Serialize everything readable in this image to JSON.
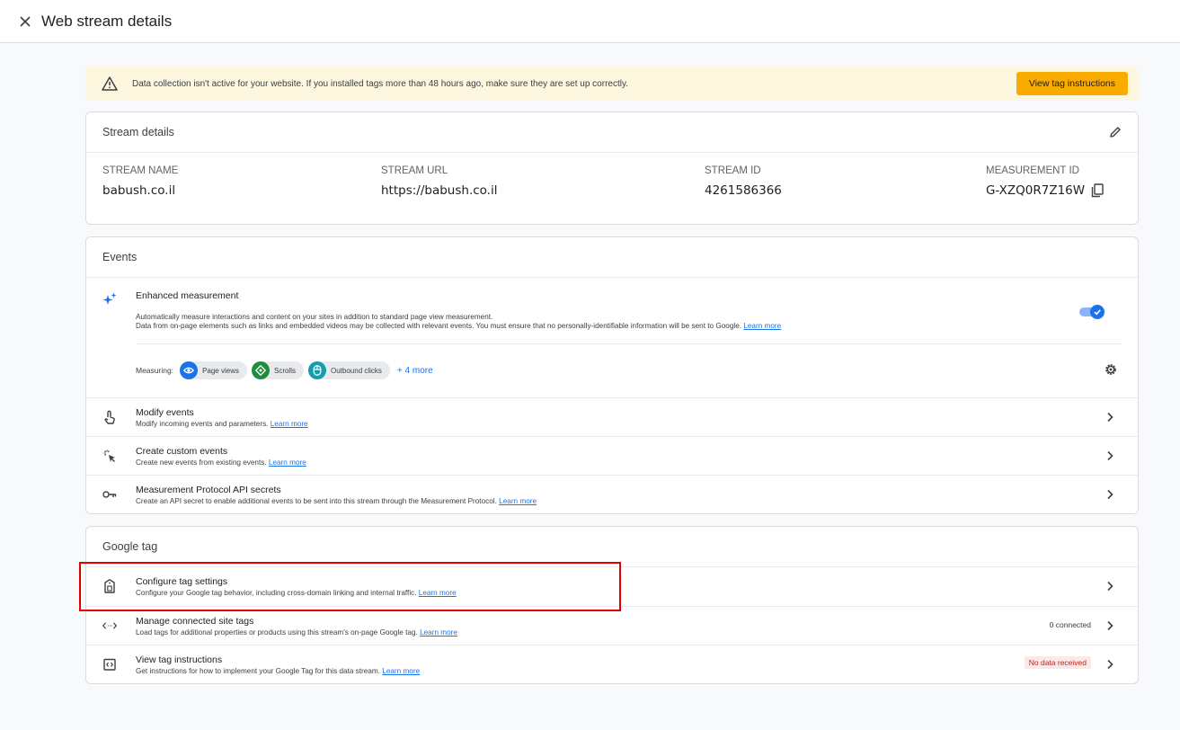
{
  "header": {
    "title": "Web stream details"
  },
  "banner": {
    "message": "Data collection isn't active for your website. If you installed tags more than 48 hours ago, make sure they are set up correctly.",
    "button_label": "View tag instructions"
  },
  "stream_details": {
    "heading": "Stream details",
    "fields": [
      {
        "label": "STREAM NAME",
        "value": "babush.co.il"
      },
      {
        "label": "STREAM URL",
        "value": "https://babush.co.il"
      },
      {
        "label": "STREAM ID",
        "value": "4261586366"
      },
      {
        "label": "MEASUREMENT ID",
        "value": "G-XZQ0R7Z16W"
      }
    ]
  },
  "events": {
    "heading": "Events",
    "enhanced": {
      "title": "Enhanced measurement",
      "desc_line1": "Automatically measure interactions and content on your sites in addition to standard page view measurement.",
      "desc_line2": "Data from on-page elements such as links and embedded videos may be collected with relevant events. You must ensure that no personally-identifiable information will be sent to Google.",
      "learn_more": "Learn more",
      "enabled": true,
      "measuring_label": "Measuring:",
      "chips": [
        {
          "label": "Page views",
          "color": "#1a73e8"
        },
        {
          "label": "Scrolls",
          "color": "#1e8e3e"
        },
        {
          "label": "Outbound clicks",
          "color": "#129eaf"
        }
      ],
      "more_label": "+ 4 more"
    },
    "rows": [
      {
        "title": "Modify events",
        "subtitle": "Modify incoming events and parameters.",
        "link": "Learn more"
      },
      {
        "title": "Create custom events",
        "subtitle": "Create new events from existing events.",
        "link": "Learn more"
      },
      {
        "title": "Measurement Protocol API secrets",
        "subtitle": "Create an API secret to enable additional events to be sent into this stream through the Measurement Protocol.",
        "link": "Learn more"
      }
    ]
  },
  "google_tag": {
    "heading": "Google tag",
    "rows": [
      {
        "title": "Configure tag settings",
        "subtitle": "Configure your Google tag behavior, including cross-domain linking and internal traffic.",
        "link": "Learn more"
      },
      {
        "title": "Manage connected site tags",
        "subtitle": "Load tags for additional properties or products using this stream's on-page Google tag.",
        "link": "Learn more",
        "status": "0 connected"
      },
      {
        "title": "View tag instructions",
        "subtitle": "Get instructions for how to implement your Google Tag for this data stream.",
        "link": "Learn more",
        "status": "No data received"
      }
    ]
  },
  "colors": {
    "accent": "#1a73e8",
    "warning_button": "#f9ab00",
    "banner_bg": "#fef7e0",
    "highlight": "#e00000"
  }
}
